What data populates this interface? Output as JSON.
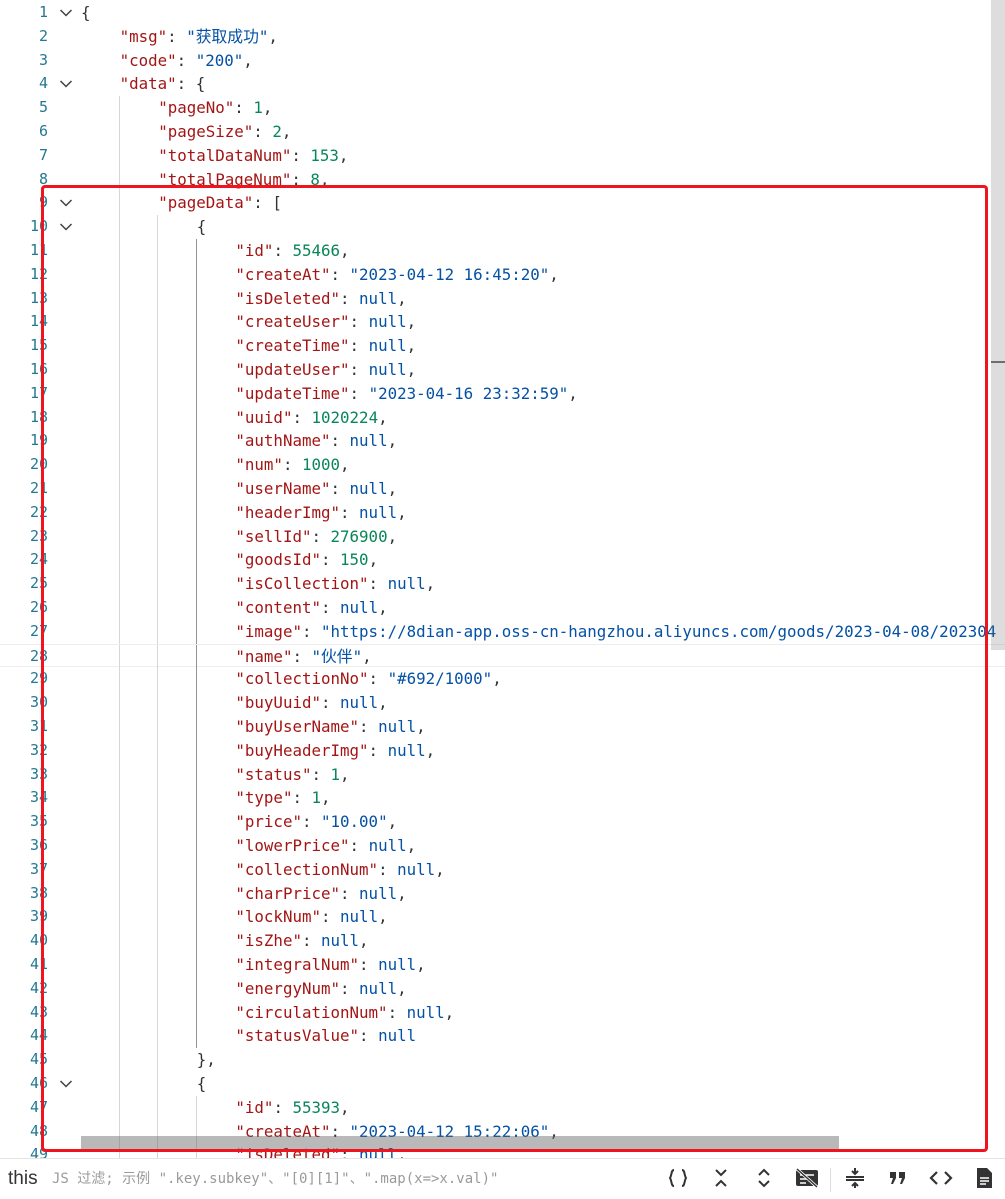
{
  "editor": {
    "lines": [
      [
        [
          "p",
          "{"
        ]
      ],
      [
        [
          "k",
          "\"msg\""
        ],
        [
          "p",
          ": "
        ],
        [
          "s",
          "\"获取成功\""
        ],
        [
          "p",
          ","
        ]
      ],
      [
        [
          "k",
          "\"code\""
        ],
        [
          "p",
          ": "
        ],
        [
          "s",
          "\"200\""
        ],
        [
          "p",
          ","
        ]
      ],
      [
        [
          "k",
          "\"data\""
        ],
        [
          "p",
          ": {"
        ]
      ],
      [
        [
          "k",
          "\"pageNo\""
        ],
        [
          "p",
          ": "
        ],
        [
          "n",
          "1"
        ],
        [
          "p",
          ","
        ]
      ],
      [
        [
          "k",
          "\"pageSize\""
        ],
        [
          "p",
          ": "
        ],
        [
          "n",
          "2"
        ],
        [
          "p",
          ","
        ]
      ],
      [
        [
          "k",
          "\"totalDataNum\""
        ],
        [
          "p",
          ": "
        ],
        [
          "n",
          "153"
        ],
        [
          "p",
          ","
        ]
      ],
      [
        [
          "k",
          "\"totalPageNum\""
        ],
        [
          "p",
          ": "
        ],
        [
          "n",
          "8"
        ],
        [
          "p",
          ","
        ]
      ],
      [
        [
          "k",
          "\"pageData\""
        ],
        [
          "p",
          ": ["
        ]
      ],
      [
        [
          "p",
          "{"
        ]
      ],
      [
        [
          "k",
          "\"id\""
        ],
        [
          "p",
          ": "
        ],
        [
          "n",
          "55466"
        ],
        [
          "p",
          ","
        ]
      ],
      [
        [
          "k",
          "\"createAt\""
        ],
        [
          "p",
          ": "
        ],
        [
          "s",
          "\"2023-04-12 16:45:20\""
        ],
        [
          "p",
          ","
        ]
      ],
      [
        [
          "k",
          "\"isDeleted\""
        ],
        [
          "p",
          ": "
        ],
        [
          "l",
          "null"
        ],
        [
          "p",
          ","
        ]
      ],
      [
        [
          "k",
          "\"createUser\""
        ],
        [
          "p",
          ": "
        ],
        [
          "l",
          "null"
        ],
        [
          "p",
          ","
        ]
      ],
      [
        [
          "k",
          "\"createTime\""
        ],
        [
          "p",
          ": "
        ],
        [
          "l",
          "null"
        ],
        [
          "p",
          ","
        ]
      ],
      [
        [
          "k",
          "\"updateUser\""
        ],
        [
          "p",
          ": "
        ],
        [
          "l",
          "null"
        ],
        [
          "p",
          ","
        ]
      ],
      [
        [
          "k",
          "\"updateTime\""
        ],
        [
          "p",
          ": "
        ],
        [
          "s",
          "\"2023-04-16 23:32:59\""
        ],
        [
          "p",
          ","
        ]
      ],
      [
        [
          "k",
          "\"uuid\""
        ],
        [
          "p",
          ": "
        ],
        [
          "n",
          "1020224"
        ],
        [
          "p",
          ","
        ]
      ],
      [
        [
          "k",
          "\"authName\""
        ],
        [
          "p",
          ": "
        ],
        [
          "l",
          "null"
        ],
        [
          "p",
          ","
        ]
      ],
      [
        [
          "k",
          "\"num\""
        ],
        [
          "p",
          ": "
        ],
        [
          "n",
          "1000"
        ],
        [
          "p",
          ","
        ]
      ],
      [
        [
          "k",
          "\"userName\""
        ],
        [
          "p",
          ": "
        ],
        [
          "l",
          "null"
        ],
        [
          "p",
          ","
        ]
      ],
      [
        [
          "k",
          "\"headerImg\""
        ],
        [
          "p",
          ": "
        ],
        [
          "l",
          "null"
        ],
        [
          "p",
          ","
        ]
      ],
      [
        [
          "k",
          "\"sellId\""
        ],
        [
          "p",
          ": "
        ],
        [
          "n",
          "276900"
        ],
        [
          "p",
          ","
        ]
      ],
      [
        [
          "k",
          "\"goodsId\""
        ],
        [
          "p",
          ": "
        ],
        [
          "n",
          "150"
        ],
        [
          "p",
          ","
        ]
      ],
      [
        [
          "k",
          "\"isCollection\""
        ],
        [
          "p",
          ": "
        ],
        [
          "l",
          "null"
        ],
        [
          "p",
          ","
        ]
      ],
      [
        [
          "k",
          "\"content\""
        ],
        [
          "p",
          ": "
        ],
        [
          "l",
          "null"
        ],
        [
          "p",
          ","
        ]
      ],
      [
        [
          "k",
          "\"image\""
        ],
        [
          "p",
          ": "
        ],
        [
          "s",
          "\"https://8dian-app.oss-cn-hangzhou.aliyuncs.com/goods/2023-04-08/202304"
        ]
      ],
      [
        [
          "k",
          "\"name\""
        ],
        [
          "p",
          ": "
        ],
        [
          "s",
          "\"伙伴\""
        ],
        [
          "p",
          ","
        ]
      ],
      [
        [
          "k",
          "\"collectionNo\""
        ],
        [
          "p",
          ": "
        ],
        [
          "s",
          "\"#692/1000\""
        ],
        [
          "p",
          ","
        ]
      ],
      [
        [
          "k",
          "\"buyUuid\""
        ],
        [
          "p",
          ": "
        ],
        [
          "l",
          "null"
        ],
        [
          "p",
          ","
        ]
      ],
      [
        [
          "k",
          "\"buyUserName\""
        ],
        [
          "p",
          ": "
        ],
        [
          "l",
          "null"
        ],
        [
          "p",
          ","
        ]
      ],
      [
        [
          "k",
          "\"buyHeaderImg\""
        ],
        [
          "p",
          ": "
        ],
        [
          "l",
          "null"
        ],
        [
          "p",
          ","
        ]
      ],
      [
        [
          "k",
          "\"status\""
        ],
        [
          "p",
          ": "
        ],
        [
          "n",
          "1"
        ],
        [
          "p",
          ","
        ]
      ],
      [
        [
          "k",
          "\"type\""
        ],
        [
          "p",
          ": "
        ],
        [
          "n",
          "1"
        ],
        [
          "p",
          ","
        ]
      ],
      [
        [
          "k",
          "\"price\""
        ],
        [
          "p",
          ": "
        ],
        [
          "s",
          "\"10.00\""
        ],
        [
          "p",
          ","
        ]
      ],
      [
        [
          "k",
          "\"lowerPrice\""
        ],
        [
          "p",
          ": "
        ],
        [
          "l",
          "null"
        ],
        [
          "p",
          ","
        ]
      ],
      [
        [
          "k",
          "\"collectionNum\""
        ],
        [
          "p",
          ": "
        ],
        [
          "l",
          "null"
        ],
        [
          "p",
          ","
        ]
      ],
      [
        [
          "k",
          "\"charPrice\""
        ],
        [
          "p",
          ": "
        ],
        [
          "l",
          "null"
        ],
        [
          "p",
          ","
        ]
      ],
      [
        [
          "k",
          "\"lockNum\""
        ],
        [
          "p",
          ": "
        ],
        [
          "l",
          "null"
        ],
        [
          "p",
          ","
        ]
      ],
      [
        [
          "k",
          "\"isZhe\""
        ],
        [
          "p",
          ": "
        ],
        [
          "l",
          "null"
        ],
        [
          "p",
          ","
        ]
      ],
      [
        [
          "k",
          "\"integralNum\""
        ],
        [
          "p",
          ": "
        ],
        [
          "l",
          "null"
        ],
        [
          "p",
          ","
        ]
      ],
      [
        [
          "k",
          "\"energyNum\""
        ],
        [
          "p",
          ": "
        ],
        [
          "l",
          "null"
        ],
        [
          "p",
          ","
        ]
      ],
      [
        [
          "k",
          "\"circulationNum\""
        ],
        [
          "p",
          ": "
        ],
        [
          "l",
          "null"
        ],
        [
          "p",
          ","
        ]
      ],
      [
        [
          "k",
          "\"statusValue\""
        ],
        [
          "p",
          ": "
        ],
        [
          "l",
          "null"
        ]
      ],
      [
        [
          "p",
          "},"
        ]
      ],
      [
        [
          "p",
          "{"
        ]
      ],
      [
        [
          "k",
          "\"id\""
        ],
        [
          "p",
          ": "
        ],
        [
          "n",
          "55393"
        ],
        [
          "p",
          ","
        ]
      ],
      [
        [
          "k",
          "\"createAt\""
        ],
        [
          "p",
          ": "
        ],
        [
          "s",
          "\"2023-04-12 15:22:06\""
        ],
        [
          "p",
          ","
        ]
      ],
      [
        [
          "k",
          "\"isDeleted\""
        ],
        [
          "p",
          ": "
        ],
        [
          "l",
          "null"
        ],
        [
          "p",
          ","
        ]
      ]
    ],
    "indent": [
      0,
      1,
      1,
      1,
      2,
      2,
      2,
      2,
      2,
      3,
      4,
      4,
      4,
      4,
      4,
      4,
      4,
      4,
      4,
      4,
      4,
      4,
      4,
      4,
      4,
      4,
      4,
      4,
      4,
      4,
      4,
      4,
      4,
      4,
      4,
      4,
      4,
      4,
      4,
      4,
      4,
      4,
      4,
      4,
      3,
      3,
      4,
      4,
      4
    ],
    "foldable_lines": [
      1,
      4,
      9,
      10,
      46
    ],
    "current_line": 28
  },
  "bottom_bar": {
    "this_label": "this",
    "filter_placeholder": "JS 过滤; 示例 \".key.subkey\"、\"[0][1]\"、\".map(x=>x.val)\""
  },
  "toolbar": [
    {
      "name": "format-braces-icon"
    },
    {
      "name": "collapse-all-icon"
    },
    {
      "name": "expand-all-icon"
    },
    {
      "name": "toggle-word-wrap-icon"
    },
    {
      "sep": true
    },
    {
      "name": "minify-icon"
    },
    {
      "name": "escape-quotes-icon"
    },
    {
      "name": "view-source-icon"
    },
    {
      "name": "save-document-icon"
    }
  ],
  "colors": {
    "key": "#a31515",
    "string": "#0451a5",
    "number": "#098658",
    "line_number": "#237893",
    "highlight_box": "#f0141e"
  }
}
